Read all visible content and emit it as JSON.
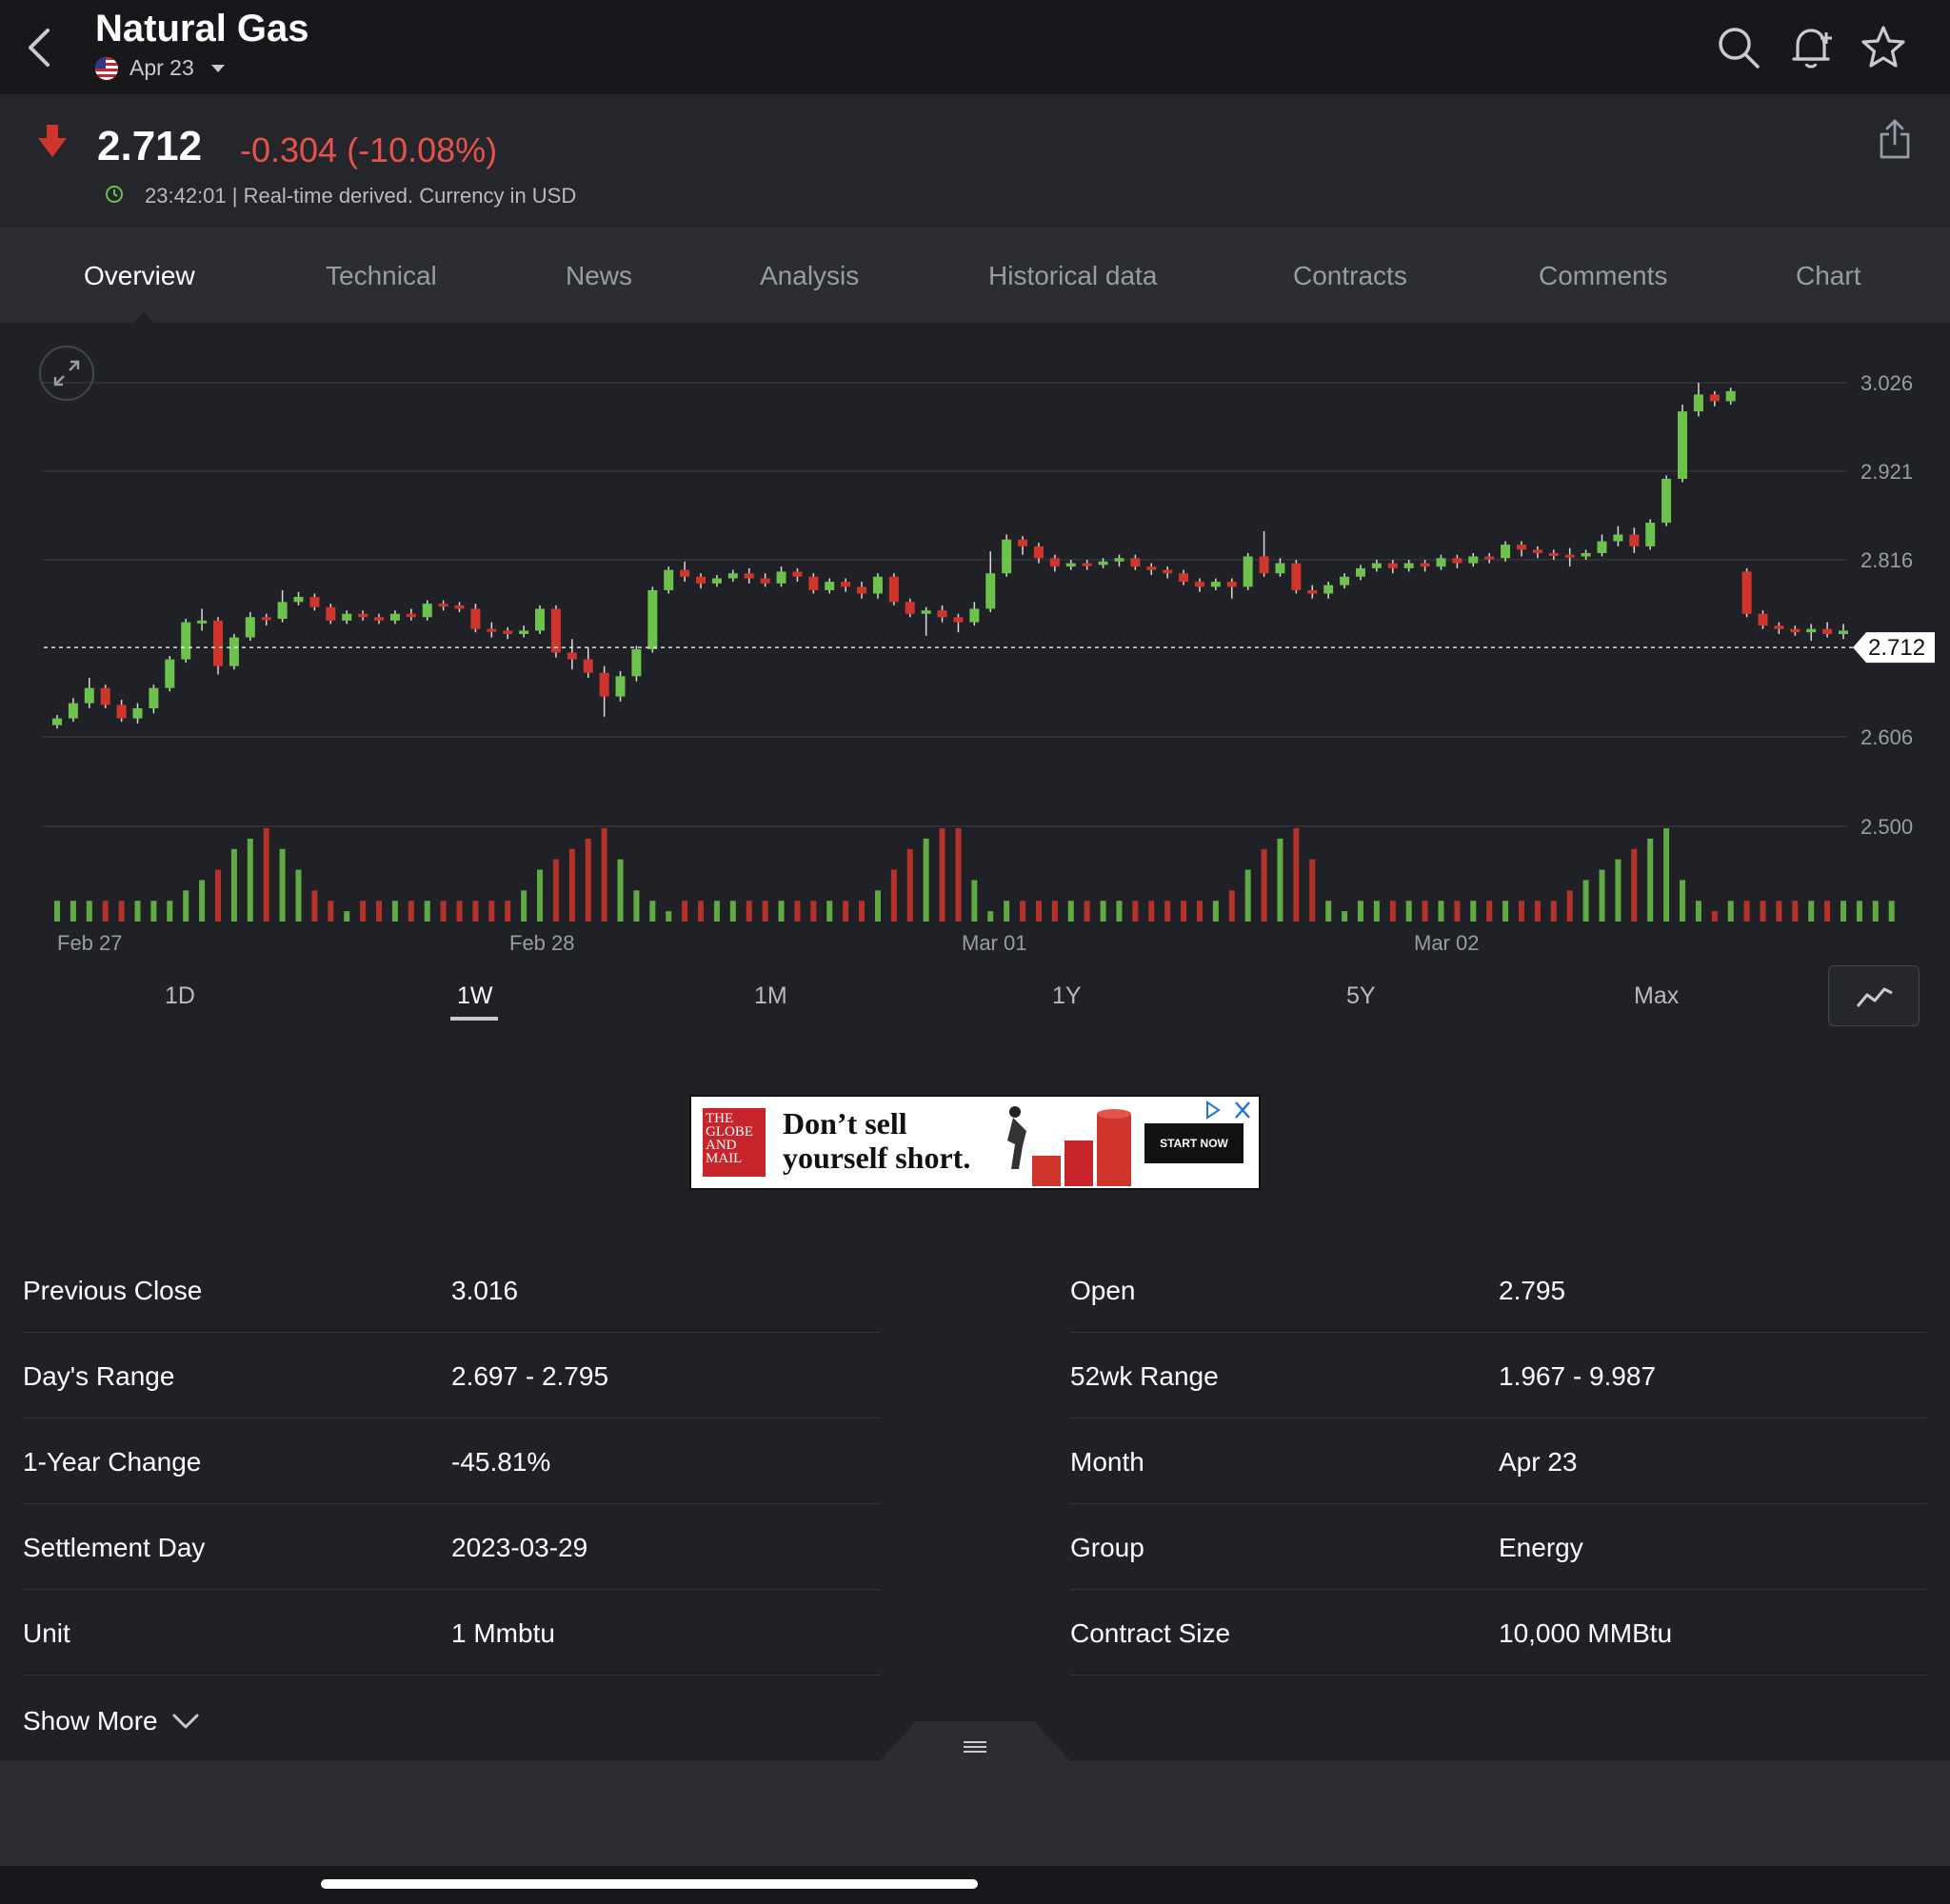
{
  "header": {
    "title": "Natural Gas",
    "contract_month": "Apr 23"
  },
  "quote": {
    "price": "2.712",
    "change": "-0.304 (-10.08%)",
    "meta": "23:42:01 | Real-time derived. Currency in USD"
  },
  "tabs": [
    "Overview",
    "Technical",
    "News",
    "Analysis",
    "Historical data",
    "Contracts",
    "Comments",
    "Chart"
  ],
  "active_tab": "Overview",
  "ranges": [
    "1D",
    "1W",
    "1M",
    "1Y",
    "5Y",
    "Max"
  ],
  "active_range": "1W",
  "ad": {
    "logo": "THE GLOBE AND MAIL",
    "text_line1": "Don’t sell",
    "text_line2": "yourself short.",
    "cta": "START NOW"
  },
  "stats": {
    "left": [
      {
        "label": "Previous Close",
        "value": "3.016"
      },
      {
        "label": "Day's Range",
        "value": "2.697 - 2.795"
      },
      {
        "label": "1-Year Change",
        "value": "-45.81%"
      },
      {
        "label": "Settlement Day",
        "value": "2023-03-29"
      },
      {
        "label": "Unit",
        "value": "1 Mmbtu"
      }
    ],
    "right": [
      {
        "label": "Open",
        "value": "2.795"
      },
      {
        "label": "52wk Range",
        "value": "1.967 - 9.987"
      },
      {
        "label": "Month",
        "value": "Apr 23"
      },
      {
        "label": "Group",
        "value": "Energy"
      },
      {
        "label": "Contract Size",
        "value": "10,000 MMBtu"
      }
    ]
  },
  "show_more": "Show More",
  "colors": {
    "up": "#6cc24a",
    "down": "#d0352c",
    "change_text": "#e5534b"
  },
  "chart_data": {
    "type": "candlestick",
    "y_ticks": [
      "3.026",
      "2.921",
      "2.816",
      "2.712",
      "2.606",
      "2.500"
    ],
    "x_labels": [
      "Feb 27",
      "Feb 28",
      "Mar 01",
      "Mar 02"
    ],
    "last_price": 2.712,
    "ylim": [
      2.5,
      3.026
    ],
    "candles": [
      [
        2.62,
        2.628,
        2.616,
        2.632
      ],
      [
        2.628,
        2.646,
        2.624,
        2.652
      ],
      [
        2.646,
        2.664,
        2.64,
        2.676
      ],
      [
        2.664,
        2.644,
        2.64,
        2.668
      ],
      [
        2.644,
        2.628,
        2.624,
        2.65
      ],
      [
        2.628,
        2.64,
        2.622,
        2.646
      ],
      [
        2.64,
        2.664,
        2.634,
        2.668
      ],
      [
        2.664,
        2.698,
        2.66,
        2.702
      ],
      [
        2.698,
        2.742,
        2.694,
        2.746
      ],
      [
        2.742,
        2.744,
        2.732,
        2.758
      ],
      [
        2.744,
        2.69,
        2.68,
        2.748
      ],
      [
        2.69,
        2.724,
        2.686,
        2.728
      ],
      [
        2.724,
        2.748,
        2.72,
        2.754
      ],
      [
        2.748,
        2.746,
        2.738,
        2.752
      ],
      [
        2.746,
        2.766,
        2.742,
        2.78
      ],
      [
        2.766,
        2.772,
        2.762,
        2.778
      ],
      [
        2.772,
        2.76,
        2.756,
        2.776
      ],
      [
        2.76,
        2.744,
        2.74,
        2.764
      ],
      [
        2.744,
        2.752,
        2.74,
        2.756
      ],
      [
        2.752,
        2.748,
        2.744,
        2.756
      ],
      [
        2.748,
        2.744,
        2.74,
        2.752
      ],
      [
        2.744,
        2.752,
        2.74,
        2.756
      ],
      [
        2.752,
        2.748,
        2.744,
        2.758
      ],
      [
        2.748,
        2.764,
        2.744,
        2.768
      ],
      [
        2.764,
        2.762,
        2.756,
        2.768
      ],
      [
        2.762,
        2.758,
        2.754,
        2.766
      ],
      [
        2.758,
        2.734,
        2.73,
        2.764
      ],
      [
        2.734,
        2.732,
        2.724,
        2.742
      ],
      [
        2.732,
        2.728,
        2.722,
        2.736
      ],
      [
        2.728,
        2.732,
        2.724,
        2.738
      ],
      [
        2.732,
        2.758,
        2.728,
        2.762
      ],
      [
        2.758,
        2.706,
        2.7,
        2.762
      ],
      [
        2.706,
        2.698,
        2.686,
        2.722
      ],
      [
        2.698,
        2.682,
        2.676,
        2.712
      ],
      [
        2.682,
        2.654,
        2.63,
        2.69
      ],
      [
        2.654,
        2.678,
        2.648,
        2.684
      ],
      [
        2.678,
        2.71,
        2.672,
        2.714
      ],
      [
        2.71,
        2.78,
        2.706,
        2.784
      ],
      [
        2.78,
        2.804,
        2.776,
        2.808
      ],
      [
        2.804,
        2.796,
        2.79,
        2.814
      ],
      [
        2.796,
        2.788,
        2.782,
        2.8
      ],
      [
        2.788,
        2.794,
        2.784,
        2.798
      ],
      [
        2.794,
        2.8,
        2.79,
        2.804
      ],
      [
        2.8,
        2.794,
        2.788,
        2.806
      ],
      [
        2.794,
        2.788,
        2.784,
        2.8
      ],
      [
        2.788,
        2.802,
        2.784,
        2.808
      ],
      [
        2.802,
        2.796,
        2.79,
        2.806
      ],
      [
        2.796,
        2.78,
        2.776,
        2.8
      ],
      [
        2.78,
        2.79,
        2.776,
        2.794
      ],
      [
        2.79,
        2.784,
        2.778,
        2.794
      ],
      [
        2.784,
        2.776,
        2.77,
        2.79
      ],
      [
        2.776,
        2.796,
        2.77,
        2.8
      ],
      [
        2.796,
        2.766,
        2.762,
        2.8
      ],
      [
        2.766,
        2.752,
        2.748,
        2.77
      ],
      [
        2.752,
        2.756,
        2.726,
        2.76
      ],
      [
        2.756,
        2.748,
        2.742,
        2.762
      ],
      [
        2.748,
        2.742,
        2.73,
        2.752
      ],
      [
        2.742,
        2.758,
        2.738,
        2.766
      ],
      [
        2.758,
        2.8,
        2.754,
        2.826
      ],
      [
        2.8,
        2.84,
        2.796,
        2.846
      ],
      [
        2.84,
        2.832,
        2.822,
        2.844
      ],
      [
        2.832,
        2.818,
        2.812,
        2.836
      ],
      [
        2.818,
        2.808,
        2.802,
        2.822
      ],
      [
        2.808,
        2.812,
        2.804,
        2.816
      ],
      [
        2.812,
        2.81,
        2.804,
        2.816
      ],
      [
        2.81,
        2.814,
        2.806,
        2.818
      ],
      [
        2.814,
        2.818,
        2.808,
        2.822
      ],
      [
        2.818,
        2.808,
        2.804,
        2.822
      ],
      [
        2.808,
        2.804,
        2.798,
        2.812
      ],
      [
        2.804,
        2.8,
        2.794,
        2.808
      ],
      [
        2.8,
        2.79,
        2.786,
        2.804
      ],
      [
        2.79,
        2.784,
        2.778,
        2.794
      ],
      [
        2.784,
        2.79,
        2.78,
        2.794
      ],
      [
        2.79,
        2.784,
        2.77,
        2.794
      ],
      [
        2.784,
        2.82,
        2.78,
        2.824
      ],
      [
        2.82,
        2.8,
        2.796,
        2.85
      ],
      [
        2.8,
        2.812,
        2.796,
        2.818
      ],
      [
        2.812,
        2.78,
        2.776,
        2.816
      ],
      [
        2.78,
        2.776,
        2.77,
        2.786
      ],
      [
        2.776,
        2.786,
        2.77,
        2.79
      ],
      [
        2.786,
        2.796,
        2.782,
        2.8
      ],
      [
        2.796,
        2.806,
        2.792,
        2.81
      ],
      [
        2.806,
        2.812,
        2.802,
        2.816
      ],
      [
        2.812,
        2.806,
        2.8,
        2.816
      ],
      [
        2.806,
        2.812,
        2.802,
        2.816
      ],
      [
        2.812,
        2.808,
        2.802,
        2.816
      ],
      [
        2.808,
        2.818,
        2.804,
        2.822
      ],
      [
        2.818,
        2.812,
        2.806,
        2.822
      ],
      [
        2.812,
        2.82,
        2.808,
        2.824
      ],
      [
        2.82,
        2.818,
        2.812,
        2.824
      ],
      [
        2.818,
        2.834,
        2.814,
        2.838
      ],
      [
        2.834,
        2.828,
        2.82,
        2.838
      ],
      [
        2.828,
        2.824,
        2.818,
        2.832
      ],
      [
        2.824,
        2.822,
        2.816,
        2.828
      ],
      [
        2.822,
        2.82,
        2.808,
        2.83
      ],
      [
        2.82,
        2.824,
        2.816,
        2.828
      ],
      [
        2.824,
        2.838,
        2.82,
        2.846
      ],
      [
        2.838,
        2.846,
        2.832,
        2.856
      ],
      [
        2.846,
        2.832,
        2.824,
        2.854
      ],
      [
        2.832,
        2.86,
        2.828,
        2.864
      ],
      [
        2.86,
        2.912,
        2.856,
        2.916
      ],
      [
        2.912,
        2.992,
        2.908,
        3.0
      ],
      [
        2.992,
        3.012,
        2.986,
        3.026
      ],
      [
        3.012,
        3.004,
        2.998,
        3.016
      ],
      [
        3.004,
        3.016,
        3.0,
        3.02
      ],
      [
        2.802,
        2.752,
        2.748,
        2.806
      ],
      [
        2.752,
        2.738,
        2.734,
        2.756
      ],
      [
        2.738,
        2.734,
        2.728,
        2.742
      ],
      [
        2.734,
        2.73,
        2.726,
        2.738
      ],
      [
        2.73,
        2.734,
        2.72,
        2.74
      ],
      [
        2.734,
        2.728,
        2.724,
        2.742
      ],
      [
        2.728,
        2.732,
        2.722,
        2.74
      ]
    ],
    "volumes": [
      2,
      2,
      2,
      2,
      2,
      2,
      2,
      2,
      3,
      4,
      5,
      7,
      8,
      9,
      7,
      5,
      3,
      2,
      1,
      2,
      2,
      2,
      2,
      2,
      2,
      2,
      2,
      2,
      2,
      3,
      5,
      6,
      7,
      8,
      9,
      6,
      3,
      2,
      1,
      2,
      2,
      2,
      2,
      2,
      2,
      2,
      2,
      2,
      2,
      2,
      2,
      3,
      5,
      7,
      8,
      9,
      9,
      4,
      1,
      2,
      2,
      2,
      2,
      2,
      2,
      2,
      2,
      2,
      2,
      2,
      2,
      2,
      2,
      3,
      5,
      7,
      8,
      9,
      6,
      2,
      1,
      2,
      2,
      2,
      2,
      2,
      2,
      2,
      2,
      2,
      2,
      2,
      2,
      2,
      3,
      4,
      5,
      6,
      7,
      8,
      9,
      4,
      2,
      1,
      2,
      2,
      2,
      2,
      2,
      2,
      2,
      2,
      2,
      2,
      2
    ]
  }
}
